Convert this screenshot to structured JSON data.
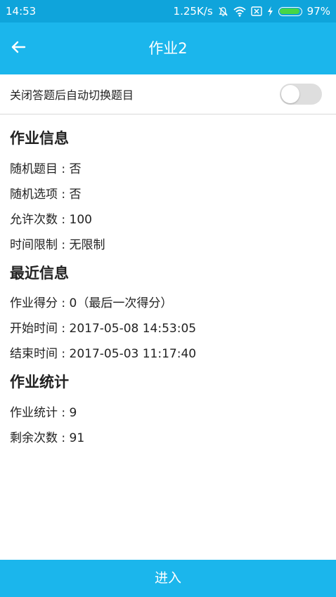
{
  "status_bar": {
    "time": "14:53",
    "speed": "1.25K/s",
    "battery": "97%",
    "battery_level": 0.97,
    "icons": [
      "notifications-muted-icon",
      "wifi-icon",
      "sim-blocked-icon",
      "charging-icon",
      "battery-icon"
    ]
  },
  "app_bar": {
    "title": "作业2",
    "back_icon": "arrow-left-icon"
  },
  "toggle_row": {
    "label": "关闭答题后自动切换题目",
    "enabled": false
  },
  "sections": {
    "homework_info": {
      "title": "作业信息",
      "random_questions": "随机题目 : 否",
      "random_options": "随机选项 : 否",
      "allowed_attempts": "允许次数 : 100",
      "time_limit": "时间限制 : 无限制"
    },
    "recent_info": {
      "title": "最近信息",
      "score": "作业得分 : 0（最后一次得分）",
      "start_time": "开始时间 : 2017-05-08 14:53:05",
      "end_time": "结束时间 : 2017-05-03 11:17:40"
    },
    "homework_stats": {
      "title": "作业统计",
      "stats": "作业统计 : 9",
      "remaining": "剩余次数 : 91"
    }
  },
  "footer": {
    "enter_label": "进入"
  },
  "colors": {
    "status_bar": "#0fa4db",
    "primary": "#1bb6ec",
    "toggle_off": "#dedede",
    "battery_fill": "#46d646"
  }
}
